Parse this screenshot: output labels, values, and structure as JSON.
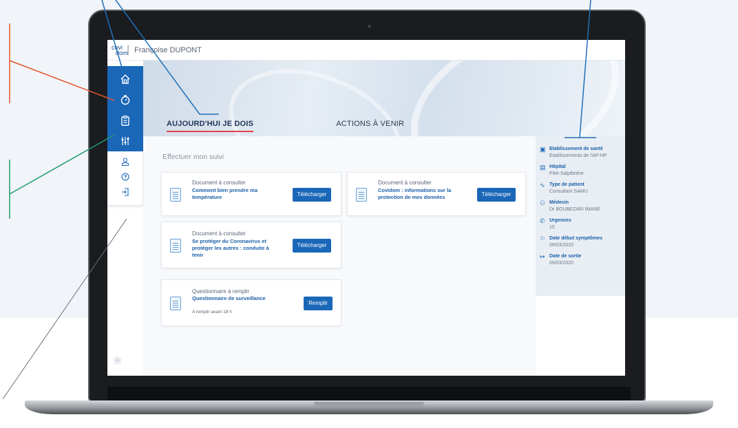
{
  "app": {
    "logo_line1": "covi",
    "logo_line2": "dom",
    "separator": "|",
    "user_name": "Françoise DUPONT"
  },
  "tabs": [
    {
      "label": "AUJOURD'HUI JE DOIS",
      "active": true
    },
    {
      "label": "ACTIONS À VENIR",
      "active": false
    }
  ],
  "sidebar": {
    "primary": [
      {
        "icon": "home-icon"
      },
      {
        "icon": "stopwatch-icon"
      },
      {
        "icon": "clipboard-icon"
      },
      {
        "icon": "sliders-icon"
      }
    ],
    "secondary": [
      {
        "icon": "user-icon"
      },
      {
        "icon": "help-icon"
      },
      {
        "icon": "logout-icon"
      }
    ]
  },
  "main": {
    "section_title": "Effectuer mon suivi",
    "cards": [
      {
        "kind": "Document à consulter",
        "title": "Comment bien prendre ma température",
        "button": "Télécharger"
      },
      {
        "kind": "Document à consulter",
        "title": "Covidom : informations sur la protection de mes données",
        "button": "Télécharger"
      },
      {
        "kind": "Document à consulter",
        "title": "Se protéger du Coronavirus et protéger les autres : conduite à tenir",
        "button": "Télécharger"
      },
      {
        "kind": "Questionnaire à remplir",
        "title": "Questionnaire de surveillance",
        "note": "A remplir avant 18 h",
        "button": "Remplir"
      }
    ]
  },
  "info_panel": [
    {
      "icon": "hospital-building-icon",
      "label": "Etablissement de santé",
      "value": "Etablissements de l'AP-HP"
    },
    {
      "icon": "institution-icon",
      "label": "Hôpital",
      "value": "Pitié-Salpêtrière"
    },
    {
      "icon": "pulse-icon",
      "label": "Type de patient",
      "value": "Consultant SAMU"
    },
    {
      "icon": "doctor-icon",
      "label": "Médecin",
      "value": "Dr BOUBEZARI IMANE"
    },
    {
      "icon": "phone-icon",
      "label": "Urgences",
      "value": "15"
    },
    {
      "icon": "flag-icon",
      "label": "Date début symptômes",
      "value": "09/03/2020"
    },
    {
      "icon": "exit-icon",
      "label": "Date de sortie",
      "value": "09/03/2020"
    }
  ],
  "colors": {
    "primary": "#1a67b8",
    "active_tab_underline": "#e4414a",
    "annotation_red": "#e4572e",
    "annotation_green": "#1f9d6b",
    "annotation_blue": "#1d6fb8"
  }
}
